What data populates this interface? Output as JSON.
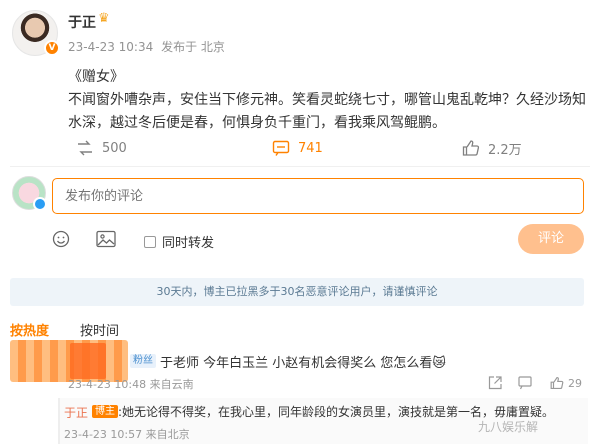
{
  "post": {
    "author": "于正",
    "date": "23-4-23 10:34",
    "posted_from": "发布于 北京",
    "title": "《赠女》",
    "text": "不闻窗外嘈杂声，安住当下修元神。笑看灵蛇绕七寸，哪管山鬼乱乾坤？久经沙场知水深，越过冬后便是春，何惧身负千重门，看我乘风驾鲲鹏。",
    "reposts": "500",
    "comments": "741",
    "likes": "2.2万"
  },
  "compose": {
    "placeholder": "发布你的评论",
    "repost_label": "同时转发",
    "submit_label": "评论"
  },
  "notice": "30天内，博主已拉黑多于30名恶意评论用户，请谨慎评论",
  "sort": {
    "hot": "按热度",
    "time": "按时间"
  },
  "comment1": {
    "badge": "粉丝",
    "text": "于老师 今年白玉兰 小赵有机会得奖么 您怎么看😿",
    "date": "23-4-23 10:48",
    "location": "来自云南",
    "likes": "29"
  },
  "reply": {
    "author": "于正",
    "badge": "博主",
    "text": ":她无论得不得奖，在我心里，同年龄段的女演员里，演技就是第一名，毋庸置疑。",
    "date": "23-4-23 10:57",
    "location": "来自北京"
  },
  "watermark": "九八娱乐解",
  "colors": {
    "accent": "#ff8200",
    "notice_bg": "#eef4f9",
    "submit_disabled": "#ffc08e"
  }
}
